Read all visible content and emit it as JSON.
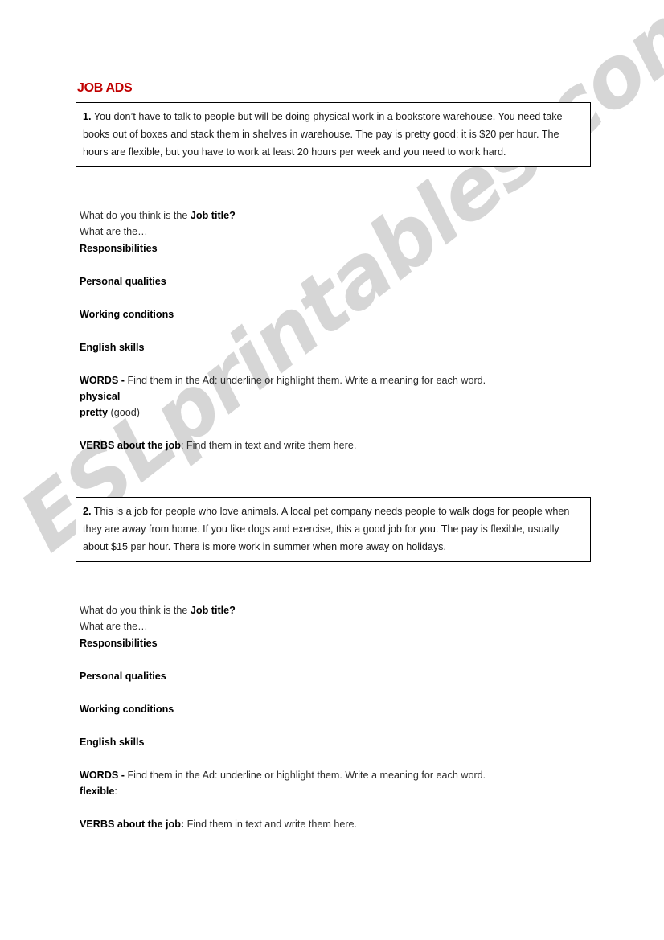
{
  "document": {
    "title": "JOB ADS",
    "title_color": "#c00000",
    "watermark": "ESLprintables.com",
    "watermark_color": "#d4d4d4"
  },
  "ads": [
    {
      "number": "1.",
      "text": "You don’t have to talk to people but will be doing physical work in a bookstore warehouse. You need take books out of boxes and stack them in shelves in warehouse. The pay is pretty good:  it is $20 per hour. The hours are flexible, but you have to work at least 20 hours per week and you need to work hard."
    },
    {
      "number": "2.",
      "text": "This is a job for people who love animals. A local pet company needs people to walk dogs for people when they are away from home. If you like dogs and exercise, this a good job for you. The pay is flexible, usually about $15 per hour. There is more work in summer when more away on holidays."
    }
  ],
  "sections": [
    {
      "job_title_prompt_plain": "What do you think is the ",
      "job_title_prompt_bold": "Job title?",
      "what_are_the": "What are the…",
      "headings": [
        "Responsibilities",
        "Personal qualities",
        "Working conditions",
        "English skills"
      ],
      "words_label": "WORDS -",
      "words_instruction": " Find them in the Ad: underline or highlight them. Write a meaning for each word.",
      "words": [
        {
          "word": "physical",
          "gloss": ""
        },
        {
          "word": "pretty",
          "gloss": " (good)"
        }
      ],
      "verbs_label": "VERBS about the job",
      "verbs_separator": ":",
      "verbs_instruction": " Find them in text and write them here."
    },
    {
      "job_title_prompt_plain": "What do you think is the ",
      "job_title_prompt_bold": "Job title?",
      "what_are_the": "What are the…",
      "headings": [
        "Responsibilities",
        "Personal qualities",
        "Working conditions",
        "English skills"
      ],
      "words_label": "WORDS -",
      "words_instruction": " Find them in the Ad: underline or highlight them. Write a meaning for each word.",
      "words": [
        {
          "word": "flexible",
          "gloss": ":"
        }
      ],
      "verbs_label": "VERBS about the job:",
      "verbs_separator": "",
      "verbs_instruction": " Find them in text and write them here."
    }
  ]
}
